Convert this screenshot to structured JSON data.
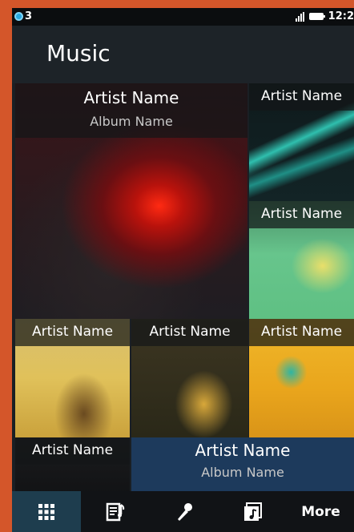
{
  "status": {
    "notification_count": "3",
    "time": "12:2"
  },
  "header": {
    "title": "Music"
  },
  "tiles": [
    {
      "artist": "Artist Name",
      "album": "Album Name"
    },
    {
      "artist": "Artist Name"
    },
    {
      "artist": "Artist Name"
    },
    {
      "artist": "Artist Name"
    },
    {
      "artist": "Artist Name"
    },
    {
      "artist": "Artist Name"
    },
    {
      "artist": "Artist Name"
    },
    {
      "artist": "Artist Name",
      "album": "Album Name"
    }
  ],
  "tabs": [
    {
      "icon": "grid-icon"
    },
    {
      "icon": "playlist-icon"
    },
    {
      "icon": "microphone-icon"
    },
    {
      "icon": "album-icon"
    },
    {
      "label": "More"
    }
  ],
  "colors": {
    "accent": "#28a8e0",
    "active_tab": "#1e3d4e",
    "frame": "#d4562a"
  }
}
